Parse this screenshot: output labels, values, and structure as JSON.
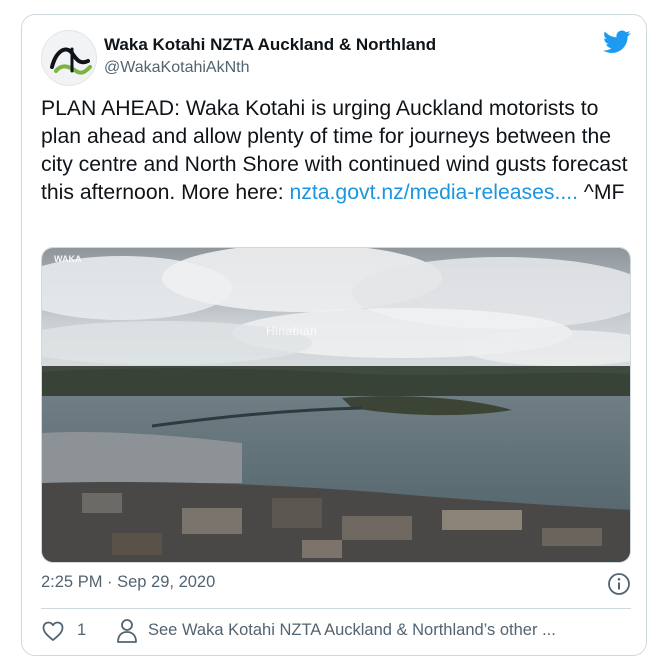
{
  "account": {
    "name": "Waka Kotahi NZTA Auckland & Northland",
    "handle": "@WakaKotahiAkNth",
    "avatar_icon": "waka-kotahi-logo"
  },
  "tweet": {
    "text_before_link": "PLAN AHEAD: Waka Kotahi  is urging Auckland motorists to plan ahead and allow plenty of time for journeys between the city centre and North Shore with continued wind gusts forecast this afternoon. More here: ",
    "link_text": "nzta.govt.nz/media-releases....",
    "text_after_link": " ^MF",
    "timestamp": "2:25 PM · Sep 29, 2020"
  },
  "media": {
    "description_icon": "aerial-photo",
    "watermark_text": "Hinabian",
    "camera_logo_text": "WAKA"
  },
  "actions": {
    "like_count": "1",
    "see_more_text": "See Waka Kotahi NZTA Auckland & Northland’s other ..."
  },
  "colors": {
    "twitter_blue": "#1d9bf0",
    "link": "#1b95e0",
    "secondary_text": "#536471",
    "border": "#cfd9de"
  }
}
